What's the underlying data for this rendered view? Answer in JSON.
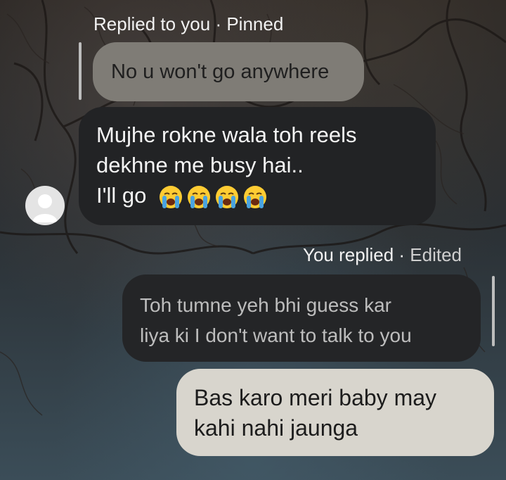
{
  "incoming": {
    "reply_header": "Replied to you · Pinned",
    "quoted_message": "No u won't go anywhere",
    "message_line1": "Mujhe rokne wala toh reels",
    "message_line2": "dekhne me busy hai..",
    "message_line3": "I'll go",
    "emoji_count": 4,
    "emoji_icon": "loudly-crying-face-icon"
  },
  "outgoing": {
    "reply_header_prefix": "You replied · ",
    "reply_header_edited": "Edited",
    "quoted_line1": "Toh tumne yeh bhi guess kar",
    "quoted_line2": "liya ki I don't want to talk to you",
    "message_line1": "Bas karo meri baby may",
    "message_line2": "kahi nahi jaunga"
  },
  "colors": {
    "quoted_bubble": "#7f7c76",
    "dark_bubble": "#222325",
    "light_bubble": "#d8d5cd",
    "emoji_face": "#ffcc33",
    "tears": "#4aa3df"
  }
}
